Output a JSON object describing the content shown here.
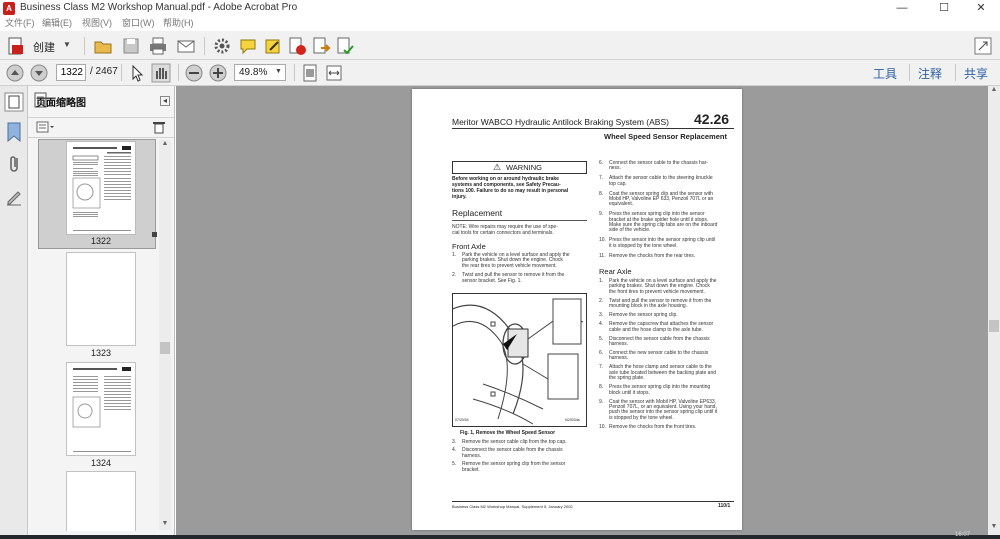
{
  "window": {
    "title": "Business Class M2 Workshop Manual.pdf - Adobe Acrobat Pro",
    "app_icon": "acrobat-icon",
    "minimize": "—",
    "maximize": "☐",
    "close": "✕"
  },
  "menu": [
    "文件(F)",
    "编辑(E)",
    "视图(V)",
    "窗口(W)",
    "帮助(H)"
  ],
  "toolbar": {
    "create_label": "创建",
    "right_tabs": [
      "工具",
      "注释",
      "共享"
    ]
  },
  "nav": {
    "current_page": "1322",
    "total_pages": "/ 2467",
    "zoom": "49.8%"
  },
  "sidebar": {
    "panel_title": "页面缩略图",
    "thumbnails": [
      {
        "label": "1322",
        "selected": true
      },
      {
        "label": "1323",
        "selected": false
      },
      {
        "label": "1324",
        "selected": false
      },
      {
        "label": "",
        "selected": false
      }
    ]
  },
  "page": {
    "header_title": "Meritor WABCO Hydraulic Antilock Braking System (ABS)",
    "section_number": "42.26",
    "subheading": "Wheel Speed Sensor Replacement",
    "warning_title": "WARNING",
    "warning_lines": [
      "Before working on or around hydraulic brake",
      "systems and components, see Safety Precau-",
      "tions 100. Failure to do so may result in personal",
      "injury."
    ],
    "replacement_heading": "Replacement",
    "note_lines": [
      "NOTE: Wire repairs may require the use of spe-",
      "cial tools for certain connectors and terminals."
    ],
    "front_axle_heading": "Front Axle",
    "front_steps_a": [
      {
        "n": "1.",
        "lines": [
          "Park the vehicle on a level surface and apply the",
          "parking brakes. Shut down the engine. Chock",
          "the rear tires to prevent vehicle movement."
        ]
      },
      {
        "n": "2.",
        "lines": [
          "Twist and pull the sensor to remove it from the",
          "sensor bracket. See Fig. 1."
        ]
      }
    ],
    "figure_code_left": "07/20/04",
    "figure_code_right": "f420034a",
    "figure_caption": "Fig. 1, Remove the Wheel Speed Sensor",
    "front_steps_b": [
      {
        "n": "3.",
        "lines": [
          "Remove the sensor cable clip from the top cap."
        ]
      },
      {
        "n": "4.",
        "lines": [
          "Disconnect the sensor cable from the chassis",
          "harness."
        ]
      },
      {
        "n": "5.",
        "lines": [
          "Remove the sensor spring clip from the sensor",
          "bracket."
        ]
      }
    ],
    "front_steps_c": [
      {
        "n": "6.",
        "lines": [
          "Connect the sensor cable to the chassis har-",
          "ness."
        ]
      },
      {
        "n": "7.",
        "lines": [
          "Attach the sensor cable to the steering knuckle",
          "top cap."
        ]
      },
      {
        "n": "8.",
        "lines": [
          "Coat the sensor spring clip and the sensor with",
          "Mobil HP, Valvoline EP 633, Penzoil 707L or an",
          "equivalent."
        ]
      },
      {
        "n": "9.",
        "lines": [
          "Press the sensor spring clip into the sensor",
          "bracket at the brake spider hole until it stops.",
          "Make sure the spring clip tabs are on the inboard",
          "side of the vehicle."
        ]
      },
      {
        "n": "10.",
        "lines": [
          "Press the sensor into the sensor spring clip until",
          "it is stopped by the tone wheel."
        ]
      },
      {
        "n": "11.",
        "lines": [
          "Remove the chocks from the rear tires."
        ]
      }
    ],
    "rear_axle_heading": "Rear Axle",
    "rear_steps": [
      {
        "n": "1.",
        "lines": [
          "Park the vehicle on a level surface and apply the",
          "parking brakes. Shut down the engine. Chock",
          "the front tires to prevent vehicle movement."
        ]
      },
      {
        "n": "2.",
        "lines": [
          "Twist and pull the sensor to remove it from the",
          "mounting block in the axle housing."
        ]
      },
      {
        "n": "3.",
        "lines": [
          "Remove the sensor spring clip."
        ]
      },
      {
        "n": "4.",
        "lines": [
          "Remove the capscrew that attaches the sensor",
          "cable and the hose clamp to the axle tube."
        ]
      },
      {
        "n": "5.",
        "lines": [
          "Disconnect the sensor cable from the chassis",
          "harness."
        ]
      },
      {
        "n": "6.",
        "lines": [
          "Connect the new sensor cable to the chassis",
          "harness."
        ]
      },
      {
        "n": "7.",
        "lines": [
          "Attach the hose clamp and sensor cable to the",
          "axle tube located between the backing plate and",
          "the spring plate."
        ]
      },
      {
        "n": "8.",
        "lines": [
          "Press the sensor spring clip into the mounting",
          "block until it stops."
        ]
      },
      {
        "n": "9.",
        "lines": [
          "Coat the sensor with Mobil HP, Valvoline EP633,",
          "Penzoil 707L, or an equivalent. Using your hand,",
          "push the sensor into the sensor spring clip until it",
          "is stopped by the tone wheel."
        ]
      },
      {
        "n": "10.",
        "lines": [
          "Remove the chocks from the front tires."
        ]
      }
    ],
    "footer_left": "Business Class M2 Workshop Manual, Supplement 5, January 2002",
    "footer_right": "110/1"
  },
  "taskbar": {
    "clock": "16:07"
  }
}
